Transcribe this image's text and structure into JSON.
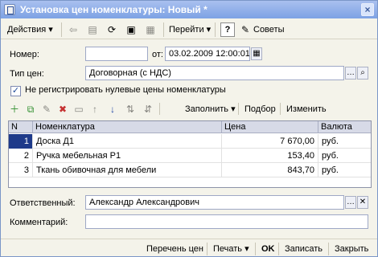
{
  "window": {
    "title": "Установка цен номенклатуры: Новый *",
    "close_glyph": "×"
  },
  "toolbar": {
    "actions_label": "Действия",
    "goto_label": "Перейти",
    "help_label": "?",
    "tips_label": "Советы",
    "icons": [
      "back-icon",
      "list-icon",
      "refresh-icon",
      "post-icon",
      "document-icon",
      "help-icon",
      "tips-icon"
    ]
  },
  "fields": {
    "number_label": "Номер:",
    "number_value": "",
    "from_label": "от:",
    "date_value": "03.02.2009 12:00:01",
    "price_type_label": "Тип цен:",
    "price_type_value": "Договорная (с НДС)",
    "checkbox_label": "Не регистрировать нулевые цены номенклатуры",
    "checkbox_checked": true,
    "responsible_label": "Ответственный:",
    "responsible_value": "Александр Александрович",
    "comment_label": "Комментарий:",
    "comment_value": ""
  },
  "grid_toolbar": {
    "fill_label": "Заполнить",
    "select_label": "Подбор",
    "change_label": "Изменить"
  },
  "table": {
    "columns": [
      "N",
      "Номенклатура",
      "Цена",
      "Валюта"
    ],
    "rows": [
      {
        "n": "1",
        "item": "Доска Д1",
        "price": "7 670,00",
        "currency": "руб."
      },
      {
        "n": "2",
        "item": "Ручка мебельная Р1",
        "price": "153,40",
        "currency": "руб."
      },
      {
        "n": "3",
        "item": "Ткань обивочная для мебели",
        "price": "843,70",
        "currency": "руб."
      }
    ]
  },
  "bottom": {
    "price_list_label": "Перечень цен",
    "print_label": "Печать",
    "ok_label": "OK",
    "save_label": "Записать",
    "close_label": "Закрыть"
  },
  "colors": {
    "title_gradient_top": "#a9c0ef",
    "title_gradient_bottom": "#7da2e4",
    "selected_row_num": "#1e3a8a"
  }
}
